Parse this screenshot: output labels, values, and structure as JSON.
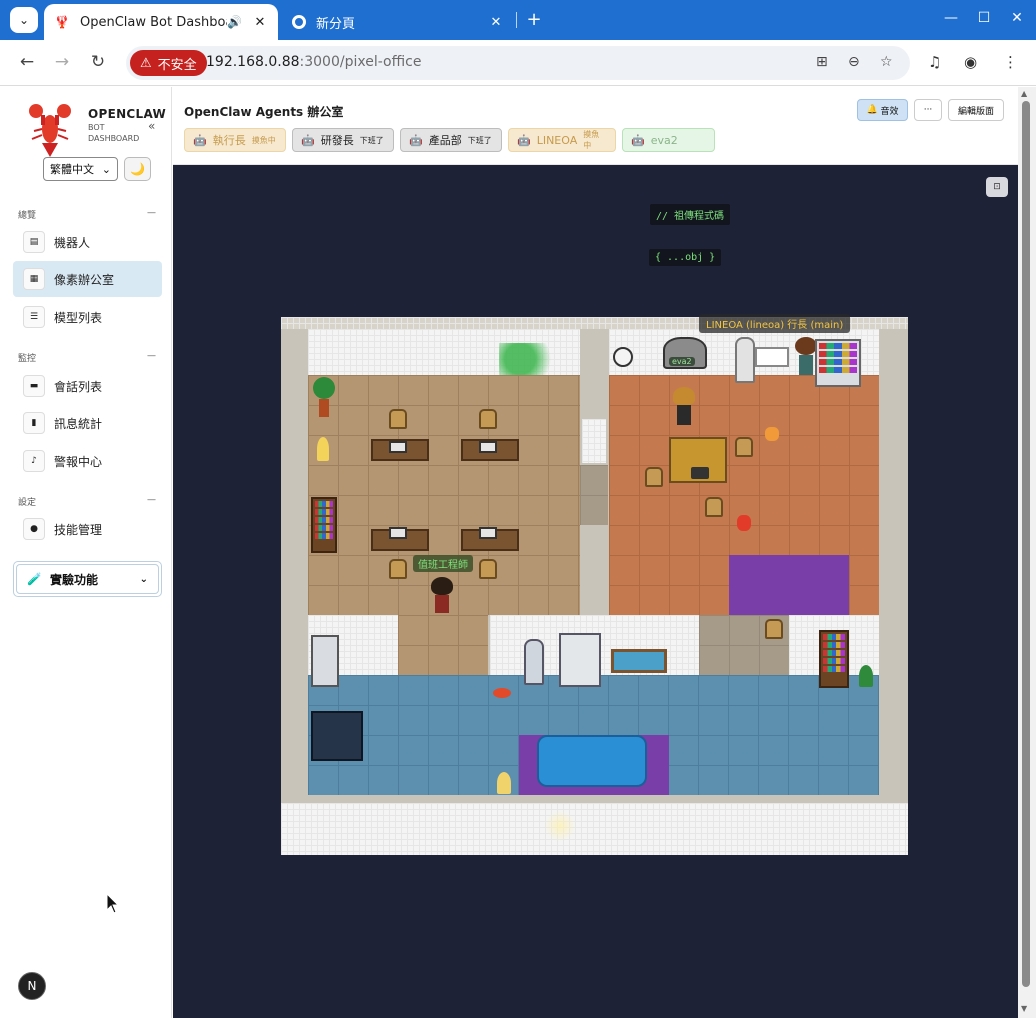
{
  "browser": {
    "tabs": [
      {
        "title": "OpenClaw Bot Dashboard",
        "active": true,
        "audio": true
      },
      {
        "title": "新分頁",
        "active": false
      }
    ],
    "insecure_label": "不安全",
    "url_host": "192.168.0.88",
    "url_rest": ":3000/pixel-office"
  },
  "sidebar": {
    "brand": "OPENCLAW",
    "brand_sub": "BOT DASHBOARD",
    "language": "繁體中文",
    "sections": [
      {
        "label": "總覽",
        "items": [
          {
            "label": "機器人"
          },
          {
            "label": "像素辦公室",
            "active": true
          },
          {
            "label": "模型列表"
          }
        ]
      },
      {
        "label": "監控",
        "items": [
          {
            "label": "會話列表"
          },
          {
            "label": "訊息統計"
          },
          {
            "label": "警報中心"
          }
        ]
      },
      {
        "label": "設定",
        "items": [
          {
            "label": "技能管理"
          }
        ]
      }
    ],
    "experimental": "實驗功能"
  },
  "header": {
    "title": "OpenClaw Agents 辦公室",
    "agents": [
      {
        "name": "執行長",
        "status": "摸魚中",
        "style": "idle"
      },
      {
        "name": "研發長",
        "status": "下班了",
        "style": "off"
      },
      {
        "name": "產品部",
        "status": "下班了",
        "style": "off"
      },
      {
        "name": "LINEOA",
        "status": "摸魚中",
        "style": "idle"
      },
      {
        "name": "eva2",
        "status": "",
        "style": "green"
      }
    ],
    "sound_btn": "音效",
    "more_btn": "···",
    "edit_btn": "編輯版面"
  },
  "office": {
    "code_tag": "// 祖傳程式碼",
    "obj_tag": "{ ...obj }",
    "agent_banner": "LINEOA (lineoa) 行長 (main)",
    "engineer_label": "值班工程師",
    "server_label": "eva2"
  },
  "colors": {
    "accent": "#1f6fd1",
    "stage_bg": "#1e2236",
    "active_nav": "#d9e9f3"
  }
}
